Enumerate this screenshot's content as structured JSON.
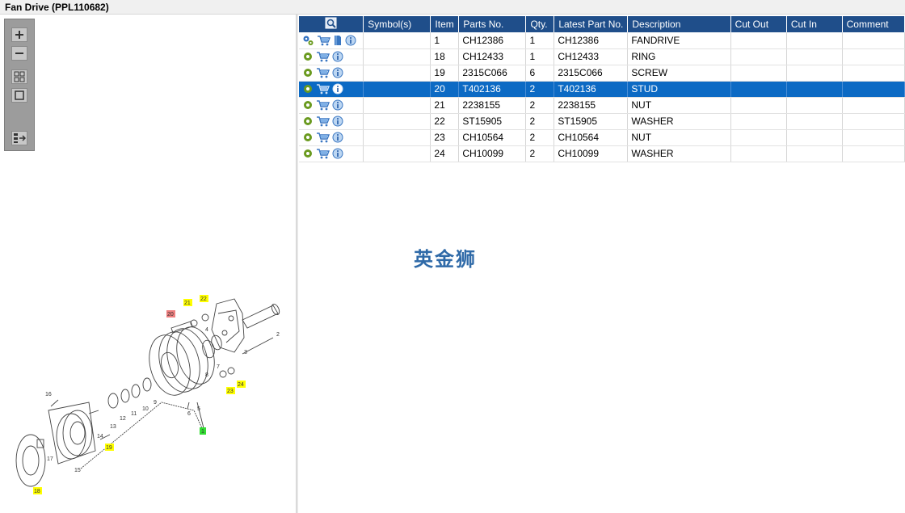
{
  "window": {
    "title": "Fan Drive (PPL110682)"
  },
  "toolbar": {
    "icons": [
      "zoom-in-icon",
      "zoom-out-icon",
      "fit-all-icon",
      "actual-size-icon",
      "list-view-icon"
    ]
  },
  "table": {
    "headers": {
      "actions": "",
      "symbols": "Symbol(s)",
      "item": "Item",
      "part_no": "Parts No.",
      "qty": "Qty.",
      "latest_part_no": "Latest Part No.",
      "description": "Description",
      "cut_out": "Cut Out",
      "cut_in": "Cut In",
      "comment": "Comment"
    },
    "rows": [
      {
        "symbol": "",
        "item": "1",
        "part_no": "CH12386",
        "qty": "1",
        "latest": "CH12386",
        "desc": "FANDRIVE",
        "cut_out": "",
        "cut_in": "",
        "comment": ""
      },
      {
        "symbol": "",
        "item": "18",
        "part_no": "CH12433",
        "qty": "1",
        "latest": "CH12433",
        "desc": "RING",
        "cut_out": "",
        "cut_in": "",
        "comment": ""
      },
      {
        "symbol": "",
        "item": "19",
        "part_no": "2315C066",
        "qty": "6",
        "latest": "2315C066",
        "desc": "SCREW",
        "cut_out": "",
        "cut_in": "",
        "comment": ""
      },
      {
        "symbol": "",
        "item": "20",
        "part_no": "T402136",
        "qty": "2",
        "latest": "T402136",
        "desc": "STUD",
        "cut_out": "",
        "cut_in": "",
        "comment": ""
      },
      {
        "symbol": "",
        "item": "21",
        "part_no": "2238155",
        "qty": "2",
        "latest": "2238155",
        "desc": "NUT",
        "cut_out": "",
        "cut_in": "",
        "comment": ""
      },
      {
        "symbol": "",
        "item": "22",
        "part_no": "ST15905",
        "qty": "2",
        "latest": "ST15905",
        "desc": "WASHER",
        "cut_out": "",
        "cut_in": "",
        "comment": ""
      },
      {
        "symbol": "",
        "item": "23",
        "part_no": "CH10564",
        "qty": "2",
        "latest": "CH10564",
        "desc": "NUT",
        "cut_out": "",
        "cut_in": "",
        "comment": ""
      },
      {
        "symbol": "",
        "item": "24",
        "part_no": "CH10099",
        "qty": "2",
        "latest": "CH10099",
        "desc": "WASHER",
        "cut_out": "",
        "cut_in": "",
        "comment": ""
      }
    ],
    "selected_item": "20"
  },
  "watermark": {
    "text": "英金狮"
  },
  "drawing": {
    "callouts": {
      "c20": "20",
      "c21": "21",
      "c22": "22",
      "c23": "23",
      "c24": "24",
      "c19": "19",
      "c18": "18",
      "c1": "1",
      "n2": "2",
      "n3": "3",
      "n4": "4",
      "n5": "5",
      "n6": "6",
      "n7": "7",
      "n8": "8",
      "n9": "9",
      "n10": "10",
      "n11": "11",
      "n12": "12",
      "n13": "13",
      "n14": "14",
      "n15": "15",
      "n16": "16",
      "n17": "17"
    }
  },
  "colors": {
    "header_bg": "#1f4e8a",
    "selected_row": "#0c6ac4",
    "callout_yellow": "#ffff00",
    "callout_red": "#f08080",
    "callout_green": "#33dd33",
    "watermark": "#2f6aa8"
  }
}
